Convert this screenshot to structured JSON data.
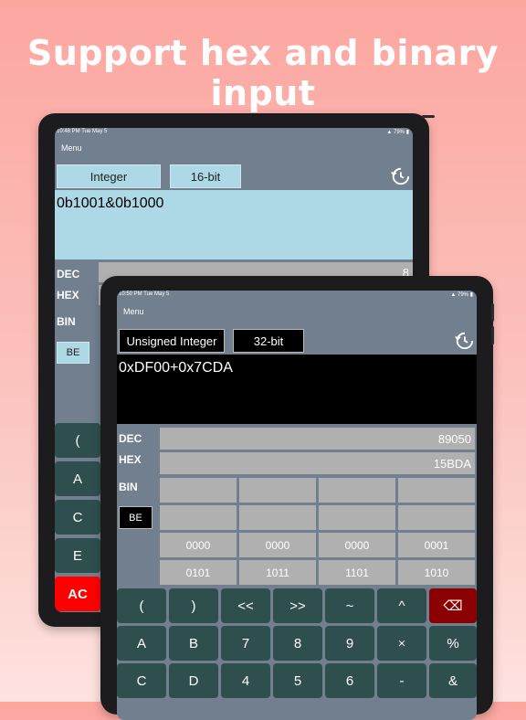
{
  "headline": "Support hex and binary input",
  "colors": {
    "accent_light": "#add8e6",
    "key": "#2f4f4f",
    "ac": "#ff0000",
    "backspace": "#8b0000"
  },
  "back_device": {
    "status_time": "10:48 PM  Tue May 5",
    "status_batt": "▲ 79% ▮",
    "menu": "Menu",
    "type_chip": "Integer",
    "bits_chip": "16-bit",
    "expression": "0b1001&0b1000",
    "dec_label": "DEC",
    "hex_label": "HEX",
    "bin_label": "BIN",
    "dec_value": "8",
    "be_label": "BE",
    "keys": [
      "(",
      "A",
      "C",
      "E",
      "AC"
    ]
  },
  "front_device": {
    "status_time": "10:50 PM  Tue May 5",
    "status_batt": "▲ 79% ▮",
    "menu": "Menu",
    "type_chip": "Unsigned Integer",
    "bits_chip": "32-bit",
    "expression": "0xDF00+0x7CDA",
    "dec_label": "DEC",
    "hex_label": "HEX",
    "bin_label": "BIN",
    "dec_value": "89050",
    "hex_value": "15BDA",
    "be_label": "BE",
    "bits_row3": [
      "0000",
      "0000",
      "0000",
      "0001"
    ],
    "bits_row4": [
      "0101",
      "1011",
      "1101",
      "1010"
    ],
    "keys_row1": [
      "(",
      ")",
      "<<",
      ">>",
      "~",
      "^",
      "⌫"
    ],
    "keys_row2": [
      "A",
      "B",
      "7",
      "8",
      "9",
      "×",
      "%"
    ],
    "keys_row3": [
      "C",
      "D",
      "4",
      "5",
      "6",
      "-",
      "&"
    ]
  }
}
